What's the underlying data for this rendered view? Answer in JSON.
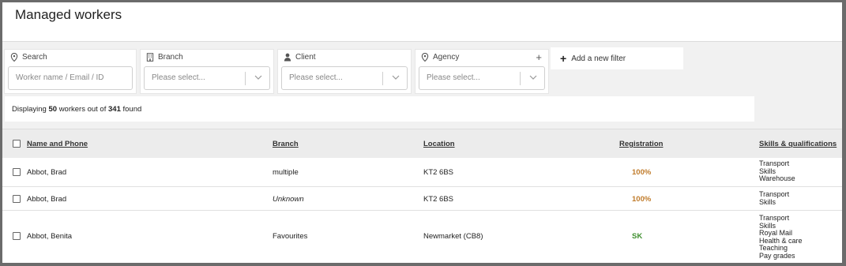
{
  "page": {
    "title": "Managed workers"
  },
  "filters": {
    "search": {
      "label": "Search",
      "placeholder": "Worker name / Email / ID"
    },
    "branch": {
      "label": "Branch",
      "value": "Please select..."
    },
    "client": {
      "label": "Client",
      "value": "Please select..."
    },
    "agency": {
      "label": "Agency",
      "value": "Please select...",
      "add_symbol": "+"
    },
    "add_filter": {
      "label": "Add a new filter"
    }
  },
  "summary": {
    "prefix": "Displaying",
    "shown": "50",
    "middle": "workers out of",
    "total": "341",
    "suffix": "found"
  },
  "table": {
    "headers": {
      "name": "Name and Phone",
      "branch": "Branch",
      "location": "Location",
      "registration": "Registration",
      "skills": "Skills & qualifications"
    },
    "rows": [
      {
        "name": "Abbot, Brad",
        "branch": "multiple",
        "location": "KT2 6BS",
        "registration": "100%",
        "skills": [
          "Transport",
          "Skills",
          "Warehouse"
        ]
      },
      {
        "name": "Abbot, Brad",
        "branch": "Unknown",
        "location": "KT2 6BS",
        "registration": "100%",
        "skills": [
          "Transport",
          "Skills"
        ]
      },
      {
        "name": "Abbot, Benita",
        "branch": "Favourites",
        "location": "Newmarket (CB8)",
        "registration": "SK",
        "skills": [
          "Transport",
          "Skills",
          "Royal Mail",
          "Health & care",
          "Teaching",
          "Pay grades"
        ]
      }
    ]
  },
  "colors": {
    "registration_percent": "#c07b2a",
    "registration_sk": "#3f8f2f"
  }
}
